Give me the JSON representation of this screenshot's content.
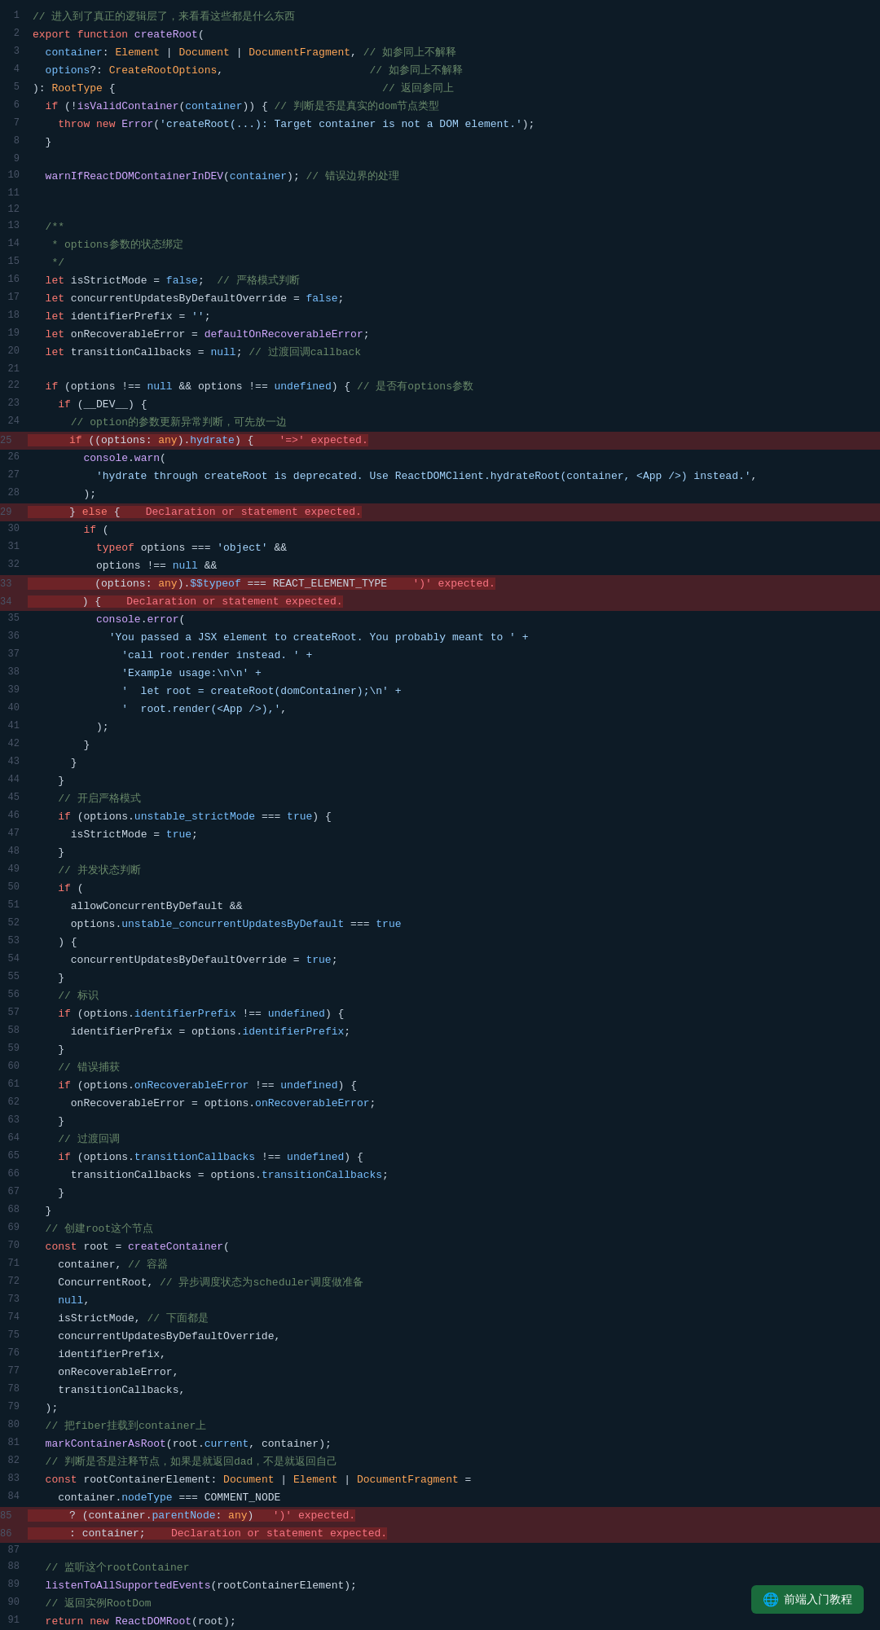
{
  "editor": {
    "lines": []
  },
  "watermark": {
    "label": "前端入门教程"
  }
}
